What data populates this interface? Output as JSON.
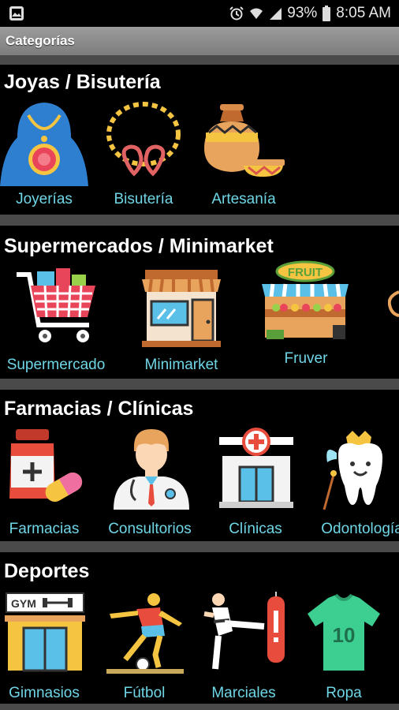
{
  "status_bar": {
    "battery": "93%",
    "time": "8:05 AM",
    "icons": [
      "gallery-icon",
      "alarm-icon",
      "wifi-icon",
      "signal-icon",
      "battery-icon"
    ]
  },
  "app_bar": {
    "title": "Categorías"
  },
  "sections": [
    {
      "title": "Joyas / Bisutería",
      "items": [
        {
          "label": "Joyerías",
          "icon": "necklace-icon"
        },
        {
          "label": "Bisutería",
          "icon": "bracelet-icon"
        },
        {
          "label": "Artesanía",
          "icon": "pottery-icon"
        }
      ]
    },
    {
      "title": "Supermercados / Minimarket",
      "items": [
        {
          "label": "Supermercado",
          "icon": "shopping-cart-icon"
        },
        {
          "label": "Minimarket",
          "icon": "store-icon"
        },
        {
          "label": "Fruver",
          "icon": "fruit-stand-icon"
        }
      ],
      "fruit_sign": "FRUIT"
    },
    {
      "title": "Farmacias / Clínicas",
      "items": [
        {
          "label": "Farmacias",
          "icon": "medicine-icon"
        },
        {
          "label": "Consultorios",
          "icon": "doctor-icon"
        },
        {
          "label": "Clínicas",
          "icon": "hospital-icon"
        },
        {
          "label": "Odontología",
          "icon": "tooth-icon"
        }
      ]
    },
    {
      "title": "Deportes",
      "items": [
        {
          "label": "Gimnasios",
          "icon": "gym-icon"
        },
        {
          "label": "Fútbol",
          "icon": "football-player-icon"
        },
        {
          "label": "Marciales",
          "icon": "martial-arts-icon"
        },
        {
          "label": "Ropa",
          "icon": "jersey-icon"
        }
      ],
      "gym_sign": "GYM",
      "jersey_number": "10"
    }
  ],
  "colors": {
    "label": "#6fd6e6",
    "divider": "#4a4a4a",
    "appbar": "#8a8a8a"
  }
}
